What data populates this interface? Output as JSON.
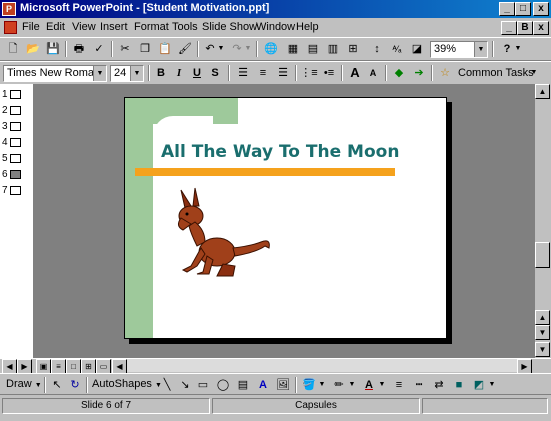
{
  "window": {
    "title": "Microsoft PowerPoint - [Student Motivation.ppt]",
    "buttons": [
      "_",
      "□",
      "x"
    ],
    "doc_buttons": [
      "_",
      "B",
      "x"
    ]
  },
  "menu": {
    "items": [
      "File",
      "Edit",
      "View",
      "Insert",
      "Format",
      "Tools",
      "Slide Show",
      "Window",
      "Help"
    ]
  },
  "standard_toolbar": {
    "zoom": "39%",
    "icons": [
      "new-icon",
      "open-icon",
      "save-icon",
      "print-icon",
      "spelling-icon",
      "cut-icon",
      "copy-icon",
      "paste-icon",
      "format-painter-icon",
      "undo-icon",
      "redo-icon",
      "hyperlink-icon",
      "tables-borders-icon",
      "insert-table-icon",
      "insert-chart-icon",
      "new-slide-icon",
      "expand-icon",
      "show-formatting-icon",
      "grayscale-icon",
      "help-icon"
    ]
  },
  "formatting_toolbar": {
    "font": "Times New Roman",
    "size": "24",
    "common_tasks": "Common Tasks"
  },
  "outline": {
    "items": [
      "1",
      "2",
      "3",
      "4",
      "5",
      "6",
      "7"
    ]
  },
  "slide": {
    "title": "All The Way To The Moon"
  },
  "drawing_toolbar": {
    "draw_label": "Draw",
    "autoshapes_label": "AutoShapes"
  },
  "status": {
    "slide_info": "Slide 6 of 7",
    "design": "Capsules"
  },
  "colors": {
    "title_bar": "#000080",
    "slide_title": "#1a6e6e",
    "accent_green": "#9ec99b",
    "accent_orange": "#f5a21d"
  }
}
